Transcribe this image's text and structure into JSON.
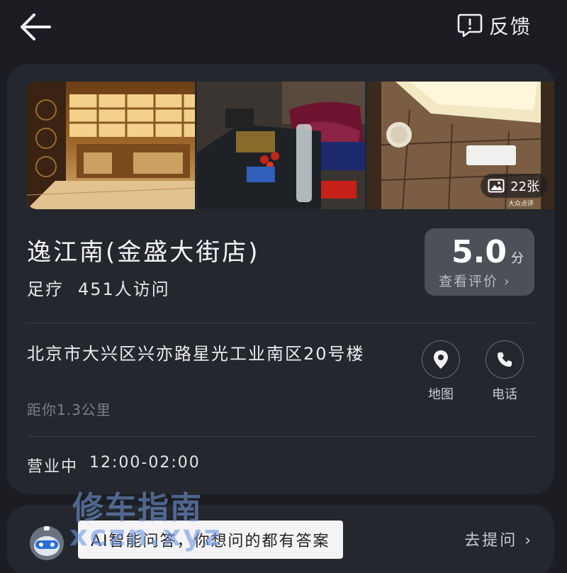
{
  "header": {
    "back_icon": "arrow-left-icon",
    "feedback_icon": "feedback-bubble-icon",
    "feedback_label": "反馈"
  },
  "shop": {
    "name": "逸江南(金盛大街店)",
    "category": "足疗",
    "visits": "451人访问",
    "photo_count": "22张",
    "photo_watermark": "大众点评",
    "rating": {
      "score": "5.0",
      "unit": "分",
      "link_label": "查看评价 ›"
    },
    "address": "北京市大兴区兴亦路星光工业南区20号楼",
    "distance": "距你1.3公里",
    "actions": [
      {
        "label": "地图",
        "icon": "location-pin-icon"
      },
      {
        "label": "电话",
        "icon": "phone-icon"
      }
    ],
    "hours_status": "营业中",
    "hours_time": "12:00-02:00"
  },
  "ask": {
    "text": "AI智能问答，你想问的都有答案",
    "link_label": "去提问 ›"
  },
  "watermark": {
    "title": "修车指南",
    "url": "xczn.xyz"
  },
  "colors": {
    "background": "#1b1d22",
    "card": "#24272d",
    "rating_box": "#4b5059"
  }
}
